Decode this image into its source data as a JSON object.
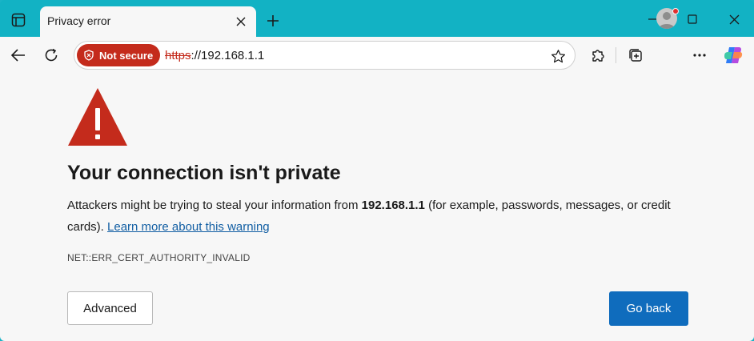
{
  "colors": {
    "frame": "#12b2c4",
    "chrome_bg": "#f7f7f7",
    "danger": "#c42b1c",
    "link": "#115ea3",
    "primary_button": "#0f6cbd"
  },
  "tab": {
    "title": "Privacy error"
  },
  "icons": {
    "tab_actions": "tab-actions-icon",
    "close": "close-icon",
    "new_tab": "plus-icon",
    "minimize": "minimize-icon",
    "maximize": "maximize-icon",
    "window_close": "close-icon",
    "back": "back-arrow-icon",
    "refresh": "refresh-icon",
    "shield": "shield-warning-icon",
    "favorite": "star-icon",
    "extensions": "puzzle-icon",
    "collections": "collections-icon",
    "more": "more-icon",
    "copilot": "copilot-icon"
  },
  "addressbar": {
    "security_label": "Not secure",
    "url_scheme": "https",
    "url_rest": "://192.168.1.1"
  },
  "page": {
    "heading": "Your connection isn't private",
    "desc_before": "Attackers might be trying to steal your information from ",
    "desc_host": "192.168.1.1",
    "desc_after": " (for example, passwords, messages, or credit cards). ",
    "learn_more": "Learn more about this warning",
    "error_code": "NET::ERR_CERT_AUTHORITY_INVALID",
    "advanced_label": "Advanced",
    "go_back_label": "Go back"
  }
}
